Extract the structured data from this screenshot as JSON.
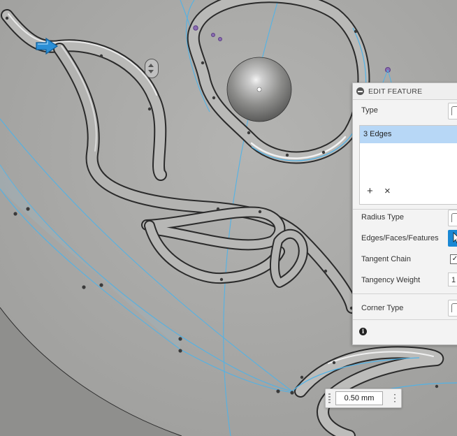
{
  "panel": {
    "title": "EDIT FEATURE",
    "type_label": "Type",
    "selection_item": "3 Edges",
    "radius_type_label": "Radius Type",
    "edges_faces_label": "Edges/Faces/Features",
    "tangent_chain_label": "Tangent Chain",
    "tangent_chain_checked": "✓",
    "tangency_weight_label": "Tangency Weight",
    "tangency_weight_value": "1",
    "corner_type_label": "Corner Type",
    "add_symbol": "+",
    "remove_symbol": "×",
    "info_symbol": "i"
  },
  "manipulator": {
    "value": "0.50 mm",
    "menu_symbol": "⋮"
  },
  "colors": {
    "surface": "#a9a9a7",
    "edge_highlight": "#4fb3e8",
    "selected_row": "#b7d7f6",
    "accent_blue": "#1a88d4"
  },
  "icons": [
    "collapse-icon",
    "plus-icon",
    "close-icon",
    "info-icon",
    "drag-arrow-icon",
    "zoom-handle-icon",
    "grip-icon",
    "more-icon"
  ]
}
